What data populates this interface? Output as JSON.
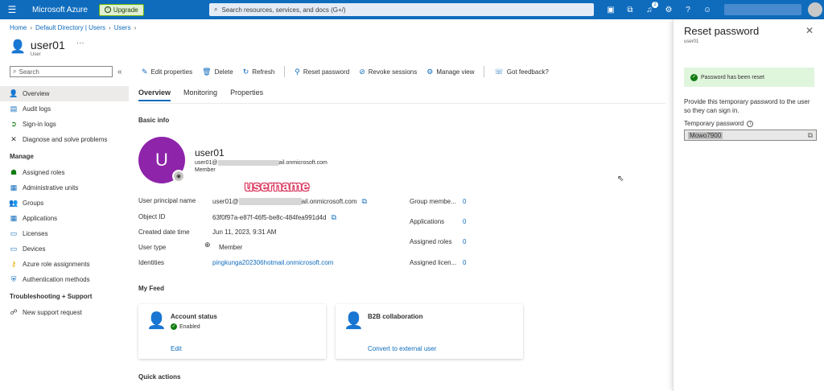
{
  "topbar": {
    "brand": "Microsoft Azure",
    "upgrade_label": "Upgrade",
    "search_placeholder": "Search resources, services, and docs (G+/)",
    "notification_count": "2",
    "icons": [
      "menu-icon",
      "cloud-shell-icon",
      "directory-icon",
      "bell-icon",
      "gear-icon",
      "help-icon",
      "feedback-icon"
    ]
  },
  "breadcrumb": [
    "Home",
    "Default Directory | Users",
    "Users"
  ],
  "page": {
    "title": "user01",
    "subtitle": "User",
    "more": "···"
  },
  "sidebar": {
    "search_placeholder": "Search",
    "collapse": "«",
    "items": [
      {
        "label": "Overview",
        "icon": "person-icon"
      },
      {
        "label": "Audit logs",
        "icon": "log-icon"
      },
      {
        "label": "Sign-in logs",
        "icon": "signin-icon"
      },
      {
        "label": "Diagnose and solve problems",
        "icon": "wrench-icon"
      }
    ],
    "manage_heading": "Manage",
    "manage_items": [
      {
        "label": "Assigned roles",
        "icon": "roles-icon"
      },
      {
        "label": "Administrative units",
        "icon": "admin-units-icon"
      },
      {
        "label": "Groups",
        "icon": "groups-icon"
      },
      {
        "label": "Applications",
        "icon": "apps-icon"
      },
      {
        "label": "Licenses",
        "icon": "license-icon"
      },
      {
        "label": "Devices",
        "icon": "device-icon"
      },
      {
        "label": "Azure role assignments",
        "icon": "key-icon"
      },
      {
        "label": "Authentication methods",
        "icon": "shield-icon"
      }
    ],
    "support_heading": "Troubleshooting + Support",
    "support_items": [
      {
        "label": "New support request",
        "icon": "support-icon"
      }
    ]
  },
  "commands": [
    {
      "label": "Edit properties",
      "icon": "pencil-icon"
    },
    {
      "label": "Delete",
      "icon": "trash-icon"
    },
    {
      "label": "Refresh",
      "icon": "refresh-icon"
    },
    {
      "label": "Reset password",
      "icon": "key-icon"
    },
    {
      "label": "Revoke sessions",
      "icon": "block-icon"
    },
    {
      "label": "Manage view",
      "icon": "gear-icon"
    },
    {
      "label": "Got feedback?",
      "icon": "feedback-icon"
    }
  ],
  "tabs": [
    "Overview",
    "Monitoring",
    "Properties"
  ],
  "basic_info": {
    "heading": "Basic info",
    "avatar_letter": "U",
    "name": "user01",
    "email_prefix": "user01@",
    "email_suffix": "ail.onmicrosoft.com",
    "role": "Member",
    "annotation": "username"
  },
  "fields": [
    {
      "key": "User principal name",
      "prefix": "user01@",
      "suffix": "ail.onmicrosoft.com"
    },
    {
      "key": "Object ID",
      "value": "63f0f97a-e87f-46f5-be8c-484fea991d4d"
    },
    {
      "key": "Created date time",
      "value": "Jun 11, 2023, 9:31 AM"
    },
    {
      "key": "User type",
      "value": "Member"
    },
    {
      "key": "Identities",
      "value": "pingkunga202306hotmail.onmicrosoft.com"
    }
  ],
  "stats": [
    {
      "key": "Group membe...",
      "value": "0"
    },
    {
      "key": "Applications",
      "value": "0"
    },
    {
      "key": "Assigned roles",
      "value": "0"
    },
    {
      "key": "Assigned licen...",
      "value": "0"
    }
  ],
  "feed": {
    "heading": "My Feed",
    "cards": [
      {
        "title": "Account status",
        "status": "Enabled",
        "link": "Edit"
      },
      {
        "title": "B2B collaboration",
        "link": "Convert to external user"
      }
    ]
  },
  "quick_actions": "Quick actions",
  "panel": {
    "title": "Reset password",
    "subtitle": "user01",
    "success": "Password has been reset",
    "description": "Provide this temporary password to the user so they can sign in.",
    "label": "Temporary password",
    "password": "Mowo7900"
  },
  "colors": {
    "brand": "#0f6cbd",
    "avatar": "#8e24aa",
    "success_bg": "#dff6dd",
    "success": "#107c10"
  }
}
